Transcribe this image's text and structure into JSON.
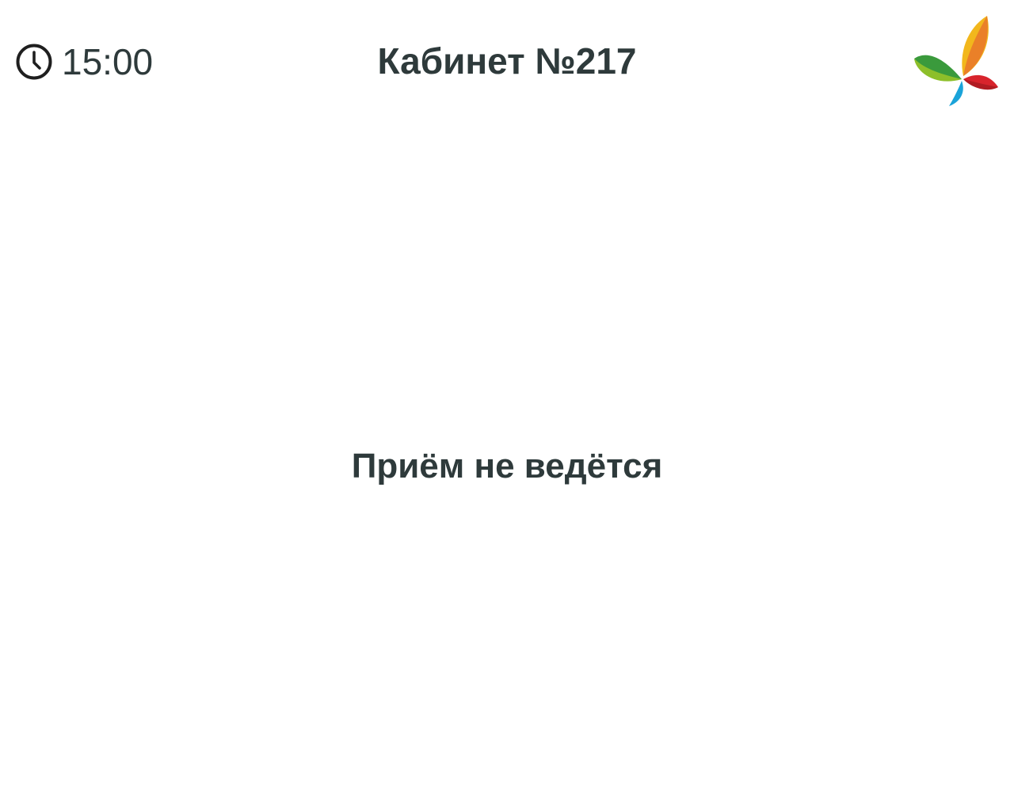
{
  "header": {
    "clock_icon": "clock-icon",
    "time": "15:00",
    "room_title": "Кабинет №217",
    "logo_icon": "leaf-logo"
  },
  "main": {
    "status_message": "Приём не ведётся"
  },
  "colors": {
    "text": "#2e3a3b",
    "background": "#ffffff",
    "logo_green": "#3a9a3c",
    "logo_lightgreen": "#8dbf2a",
    "logo_yellow": "#f2b71c",
    "logo_orange": "#e9772a",
    "logo_red": "#d8242c",
    "logo_blue": "#1aa3d9"
  }
}
